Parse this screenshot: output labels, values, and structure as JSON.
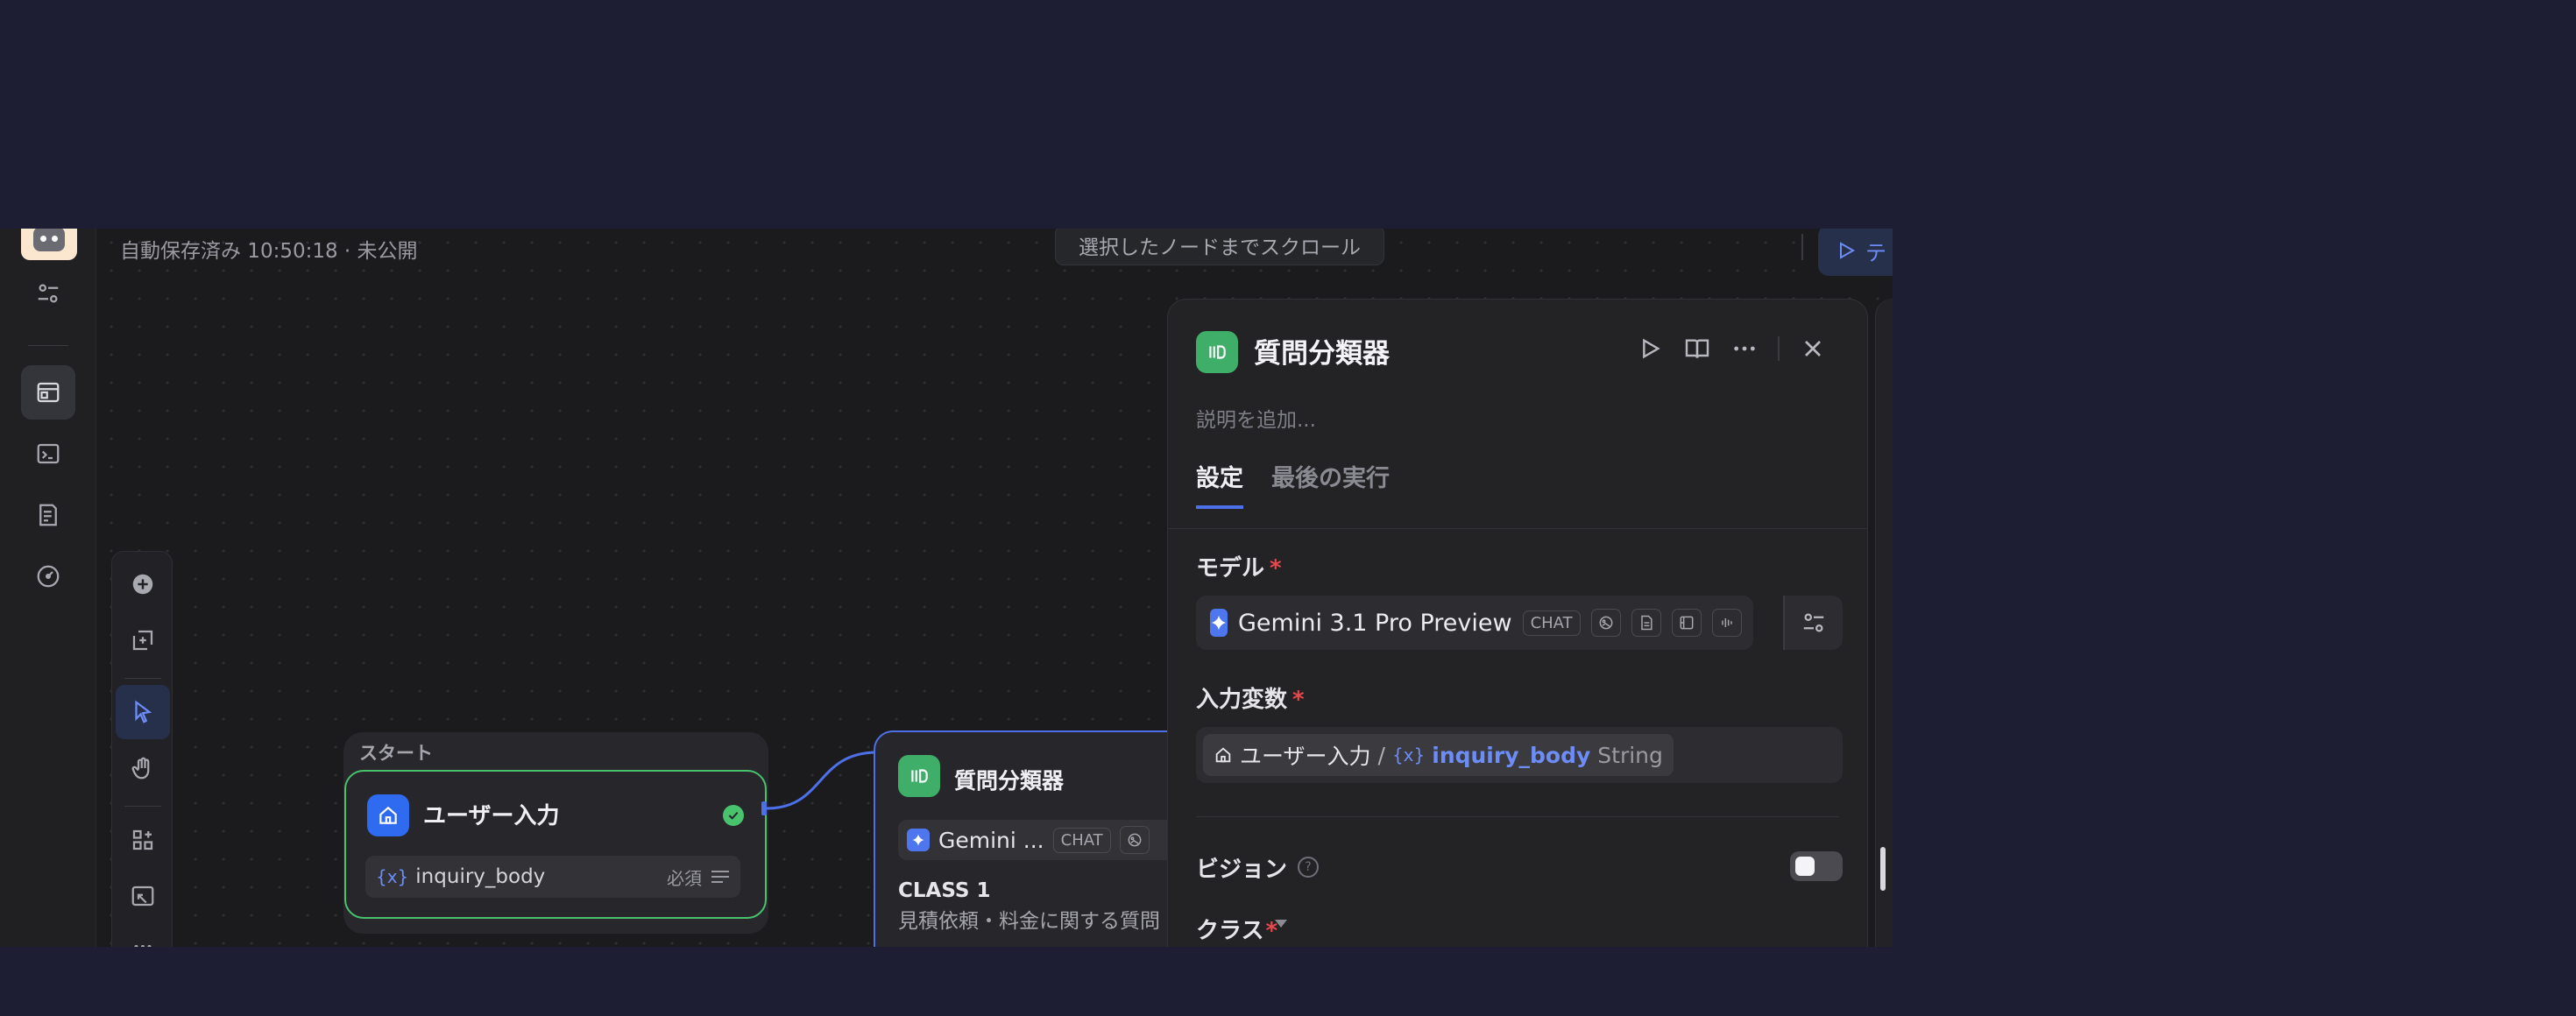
{
  "header": {
    "autosave": "自動保存済み 10:50:18 · 未公開",
    "scroll_button": "選択したノードまでスクロール",
    "test_run": "テ"
  },
  "sidebar": {
    "items": [
      {
        "icon": "settings-sliders-icon"
      },
      {
        "icon": "workflow-app-icon",
        "active": true
      },
      {
        "icon": "terminal-icon"
      },
      {
        "icon": "logs-icon"
      },
      {
        "icon": "monitoring-gauge-icon"
      }
    ]
  },
  "toolbar": {
    "tools": [
      "add-node",
      "add-note",
      "pointer",
      "hand",
      "organize",
      "minimap",
      "more"
    ]
  },
  "start_node": {
    "group_label": "スタート",
    "title": "ユーザー入力",
    "var_glyph": "{x}",
    "var_name": "inquiry_body",
    "required": "必須"
  },
  "classifier_node": {
    "title": "質問分類器",
    "model_name": "Gemini ...",
    "chip": "CHAT",
    "class_label": "CLASS 1",
    "class_desc": "見積依頼・料金に関する質問"
  },
  "panel": {
    "title": "質問分類器",
    "description_placeholder": "説明を追加...",
    "tabs": [
      {
        "label": "設定",
        "active": true
      },
      {
        "label": "最後の実行",
        "active": false
      }
    ],
    "model_label": "モデル",
    "required_mark": "*",
    "model_name": "Gemini 3.1 Pro Preview",
    "model_chip": "CHAT",
    "input_var_label": "入力変数",
    "var_node": "ユーザー入力",
    "var_slash": "/",
    "var_glyph": "{x}",
    "var_name": "inquiry_body",
    "var_type": "String",
    "vision_label": "ビジョン",
    "vision_help": "?",
    "vision_enabled": false,
    "class_label": "クラス"
  },
  "colors": {
    "accent_blue": "#4d70e8",
    "start_green": "#49c26e",
    "classifier_green": "#3fae68",
    "required_red": "#e5484d"
  }
}
